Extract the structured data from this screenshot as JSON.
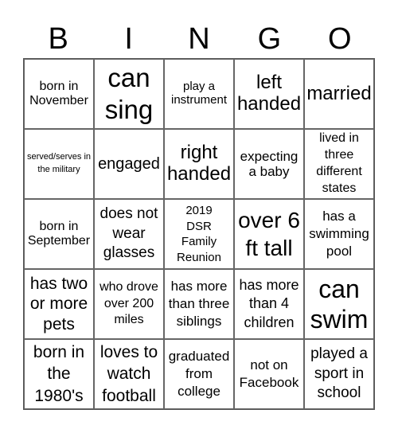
{
  "header": {
    "letters": [
      "B",
      "I",
      "N",
      "G",
      "O"
    ]
  },
  "cells": [
    "born in November",
    "can sing",
    "play a instrument",
    "left handed",
    "married",
    "served/serves in the military",
    "engaged",
    "right handed",
    "expecting a baby",
    "lived in three different states",
    "born in September",
    "does not wear glasses",
    "2019 DSR Family Reunion",
    "over 6 ft tall",
    "has a swimming pool",
    "has two or more pets",
    "who drove over 200 miles",
    "has more than three siblings",
    "has more than 4 children",
    "can swim",
    "born in the 1980's",
    "loves to watch football",
    "graduated from college",
    "not on Facebook",
    "played a sport in school"
  ]
}
